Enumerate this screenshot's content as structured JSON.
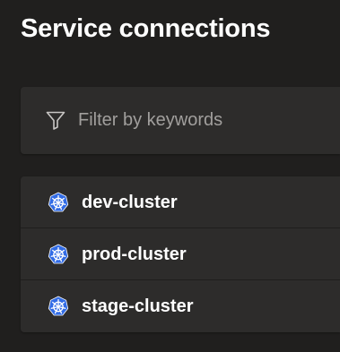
{
  "page": {
    "title": "Service connections"
  },
  "filter": {
    "icon": "filter-icon",
    "placeholder": "Filter by keywords",
    "value": ""
  },
  "connections": [
    {
      "name": "dev-cluster",
      "icon": "kubernetes-icon"
    },
    {
      "name": "prod-cluster",
      "icon": "kubernetes-icon"
    },
    {
      "name": "stage-cluster",
      "icon": "kubernetes-icon"
    }
  ],
  "colors": {
    "background": "#201f1e",
    "surface": "#2d2c2b",
    "text": "#ffffff",
    "placeholder": "#a19f9d",
    "kubernetes_brand": "#326ce5"
  }
}
